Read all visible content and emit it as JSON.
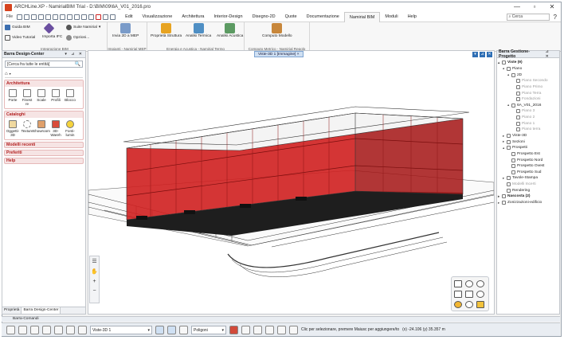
{
  "window": {
    "title": "ARCHLine.XP - NamirialBIM Trial - D:\\BIM\\09\\6A_V01_2016.pro",
    "buttons": [
      "—",
      "▫",
      "✕"
    ]
  },
  "ribbon": {
    "file_label": "File",
    "tabs": [
      "Edit",
      "Visualizzazione",
      "Architettura",
      "Interior-Design",
      "Disegno-2D",
      "Quote",
      "Documentazione",
      "Namirial BIM",
      "Moduli",
      "Help"
    ],
    "active_tab": "Namirial BIM",
    "search_placeholder": "Cerca",
    "help_label": "?",
    "groups": [
      {
        "label": "Integrazione BIM",
        "buttons": [
          "Guida BIM",
          "Suite Namirial",
          "Video Tutorial",
          "Importa IFC",
          "Opzioni..."
        ]
      },
      {
        "label": "Impianti - Namirial MEP",
        "buttons": [
          "Invia 2D a MEP"
        ]
      },
      {
        "label": "Energia e Acustica - Namirial Termo",
        "buttons": [
          "Proprietà Struttura",
          "Analisi Termica",
          "Analisi Acustica"
        ]
      },
      {
        "label": "Computo Metrico - Namirial Regolo",
        "buttons": [
          "Computo Modello"
        ]
      }
    ]
  },
  "left_panel": {
    "title": "Barra Design-Center",
    "header_buttons": "▾ ⊿ ✕",
    "search_placeholder": "[Cerca fra tutte le entità]",
    "search_icon": "🔍",
    "home_icon": "⌂",
    "architettura": {
      "title": "Architettura",
      "tools": [
        "Porte",
        "Finest re",
        "Scale",
        "Profili",
        "Blocco"
      ]
    },
    "cataloghi": {
      "title": "Cataloghi",
      "tools": [
        "Oggetti-3D",
        "Texture",
        "Showroom",
        "3D-Wareh",
        "Fonti-lumin"
      ]
    },
    "collapsed_sections": [
      "Modelli recenti",
      "Preferiti",
      "Help"
    ],
    "bottom_tabs": [
      "Proprietà",
      "Barra Design-Center"
    ]
  },
  "viewport": {
    "view_tab": "Viste-3D 1 [Immagine] ×",
    "left_tools": [
      "☰",
      "✋",
      "+",
      "−"
    ],
    "corner_buttons": [
      "▾",
      "⊿",
      "✕"
    ]
  },
  "right_panel": {
    "title": "Barra Gestione-Progetto",
    "header_buttons": "⊿ ✕",
    "tree": [
      {
        "label": "Viste (9)",
        "level": 0,
        "toggle": "▴",
        "style": "bold"
      },
      {
        "label": "Piano",
        "level": 1,
        "toggle": "▴",
        "style": ""
      },
      {
        "label": "2D",
        "level": 2,
        "toggle": "▴",
        "style": ""
      },
      {
        "label": "Piano Secondo",
        "level": 3,
        "toggle": "",
        "style": "dim"
      },
      {
        "label": "Piano Primo",
        "level": 3,
        "toggle": "",
        "style": "dim"
      },
      {
        "label": "Piano Terra",
        "level": 3,
        "toggle": "",
        "style": "dim"
      },
      {
        "label": "Fondazioni",
        "level": 3,
        "toggle": "",
        "style": "dim"
      },
      {
        "label": "6A_V01_2016",
        "level": 2,
        "toggle": "▴",
        "style": ""
      },
      {
        "label": "Piano 3",
        "level": 3,
        "toggle": "",
        "style": "dim"
      },
      {
        "label": "Piano 2",
        "level": 3,
        "toggle": "",
        "style": "dim"
      },
      {
        "label": "Piano 1",
        "level": 3,
        "toggle": "",
        "style": "dim"
      },
      {
        "label": "Piano terra",
        "level": 3,
        "toggle": "",
        "style": "dim"
      },
      {
        "label": "Viste-3D",
        "level": 1,
        "toggle": "▸",
        "style": ""
      },
      {
        "label": "Sezioni",
        "level": 1,
        "toggle": "▸",
        "style": ""
      },
      {
        "label": "Prospetti",
        "level": 1,
        "toggle": "▴",
        "style": ""
      },
      {
        "label": "Prospetto Est",
        "level": 2,
        "toggle": "",
        "style": ""
      },
      {
        "label": "Prospetto Nord",
        "level": 2,
        "toggle": "",
        "style": ""
      },
      {
        "label": "Prospetto Ovest",
        "level": 2,
        "toggle": "",
        "style": ""
      },
      {
        "label": "Prospetto Sud",
        "level": 2,
        "toggle": "",
        "style": ""
      },
      {
        "label": "Tavole-Stampa",
        "level": 1,
        "toggle": "▸",
        "style": ""
      },
      {
        "label": "Modelli Incerti",
        "level": 1,
        "toggle": "",
        "style": "dim"
      },
      {
        "label": "Rendering",
        "level": 1,
        "toggle": "",
        "style": ""
      },
      {
        "label": "Nascosta (2)",
        "level": 0,
        "toggle": "▸",
        "style": "bold"
      },
      {
        "label": "Zonizzazioni-edificio",
        "level": 0,
        "toggle": "▸",
        "style": ""
      }
    ]
  },
  "command_bar": {
    "label": "Barra-Comandi"
  },
  "status_bar": {
    "view_select": "Viste-3D 1",
    "shape_select": "Poligoni",
    "hint": "Clic per selezionare, premere Maiusc per aggiungere/to",
    "coords": "(x) -24.106  (y) 35.357 m"
  },
  "colors": {
    "accent": "#2f6fb5",
    "building_red": "#d62424",
    "section_red": "#b21e1e"
  }
}
